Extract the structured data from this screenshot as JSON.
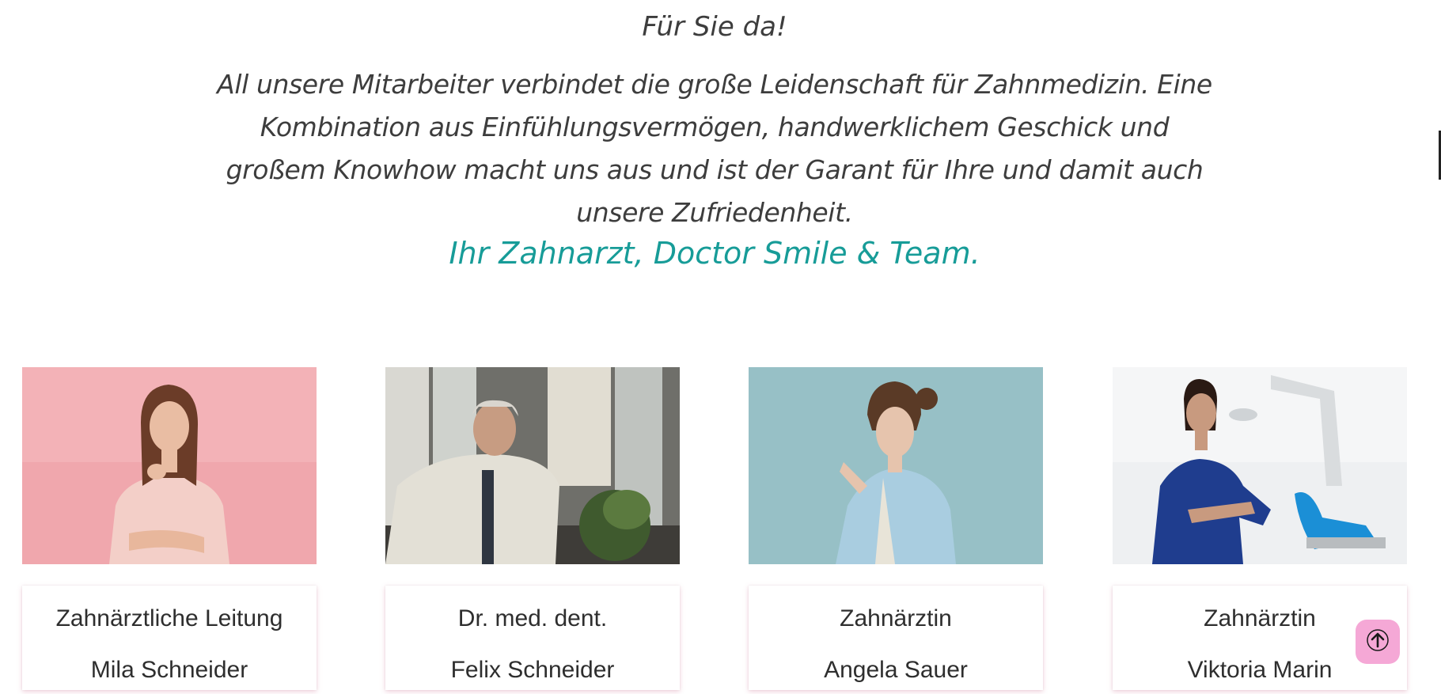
{
  "intro": {
    "greeting": "Für Sie da!",
    "paragraph": "All unsere Mitarbeiter verbindet die große Leidenschaft für Zahnmedizin. Eine Kombination aus Einfühlungsvermögen, handwerklichem Geschick und großem Knowhow macht uns aus und ist der Garant für Ihre und damit auch unsere Zufriedenheit.",
    "signature": "Ihr Zahnarzt, Doctor Smile & Team."
  },
  "team": [
    {
      "role": "Zahnärztliche Leitung",
      "name": "Mila Schneider"
    },
    {
      "role": "Dr. med. dent.",
      "name": "Felix Schneider"
    },
    {
      "role": "Zahnärztin",
      "name": "Angela Sauer"
    },
    {
      "role": "Zahnärztin",
      "name": "Viktoria Marin"
    }
  ],
  "colors": {
    "accent": "#179c98",
    "scroll_button": "#f5a8d6"
  },
  "icons": {
    "scroll_top": "arrow-up-icon"
  }
}
